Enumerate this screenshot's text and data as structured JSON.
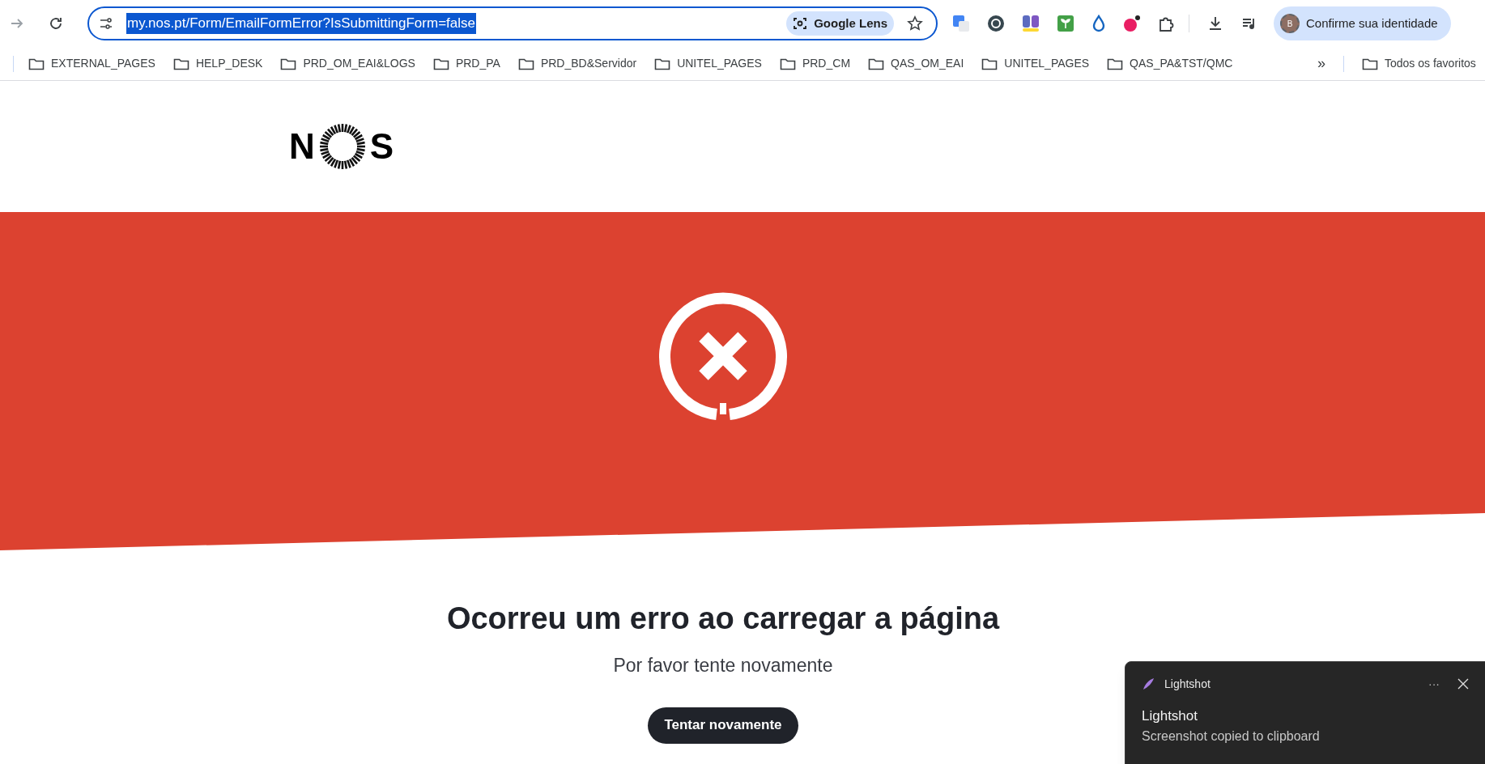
{
  "browser": {
    "url": "my.nos.pt/Form/EmailFormError?IsSubmittingForm=false",
    "url_selected": true,
    "lens_label": "Google Lens",
    "profile_initial": "B",
    "profile_label": "Confirme sua identidade",
    "bookmarks": [
      "EXTERNAL_PAGES",
      "HELP_DESK",
      "PRD_OM_EAI&LOGS",
      "PRD_PA",
      "PRD_BD&Servidor",
      "UNITEL_PAGES",
      "PRD_CM",
      "QAS_OM_EAI",
      "UNITEL_PAGES",
      "QAS_PA&TST/QMC"
    ],
    "overflow": "»",
    "all_bookmarks": "Todos os favoritos"
  },
  "page": {
    "logo": {
      "left": "N",
      "right": "S"
    },
    "title": "Ocorreu um erro ao carregar a página",
    "subtitle": "Por favor tente novamente",
    "button": "Tentar novamente"
  },
  "toast": {
    "app": "Lightshot",
    "more": "···",
    "heading": "Lightshot",
    "message": "Screenshot copied to clipboard"
  }
}
